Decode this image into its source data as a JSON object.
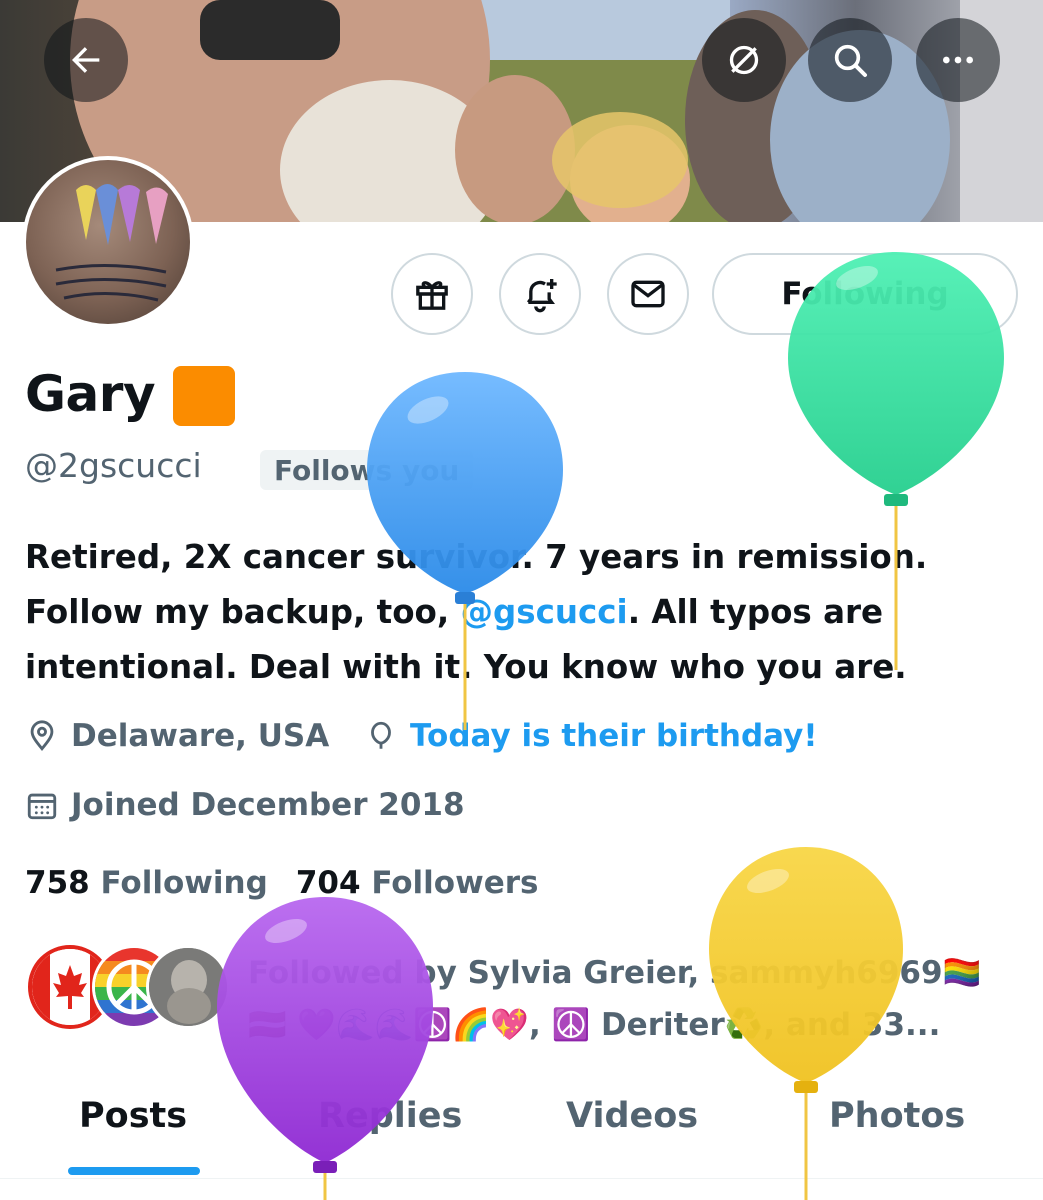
{
  "header": {
    "back_icon": "arrow-left-icon",
    "grok_icon": "grok-slash-icon",
    "search_icon": "search-icon",
    "more_icon": "more-horizontal-icon"
  },
  "actions": {
    "gift_icon": "gift-icon",
    "notify_icon": "bell-plus-icon",
    "message_icon": "envelope-icon",
    "following_label": "Following"
  },
  "profile": {
    "name": "Gary",
    "handle": "@2gscucci",
    "follows_you": "Follows you",
    "bio_part1": "Retired, 2X cancer survivor. 7 years in remission. Follow my backup, too, ",
    "bio_link": "@gscucci",
    "bio_part2": ". All typos are intentional. Deal with it. You know who you are.",
    "location": "Delaware, USA",
    "birthday": "Today is their birthday!",
    "joined": "Joined December 2018"
  },
  "stats": {
    "following_count": "758",
    "following_label": "Following",
    "followers_count": "704",
    "followers_label": "Followers"
  },
  "followed_by": {
    "line1": "Followed by Sylvia Greier, sammyh6969🏳️‍🌈",
    "line2": "🇱🇻 💜🌊🌊☮️🌈💖, ☮️ Deriter♻️, and 33..."
  },
  "tabs": {
    "posts": "Posts",
    "replies": "Replies",
    "videos": "Videos",
    "photos": "Photos"
  },
  "colors": {
    "accent": "#1d9bf0",
    "secondary_text": "#536471",
    "balloon_blue": "#3a9bf0",
    "balloon_green": "#35e0a0",
    "balloon_purple": "#a23de0",
    "balloon_yellow": "#f6cf2e",
    "name_badge": "#fb8c00"
  }
}
